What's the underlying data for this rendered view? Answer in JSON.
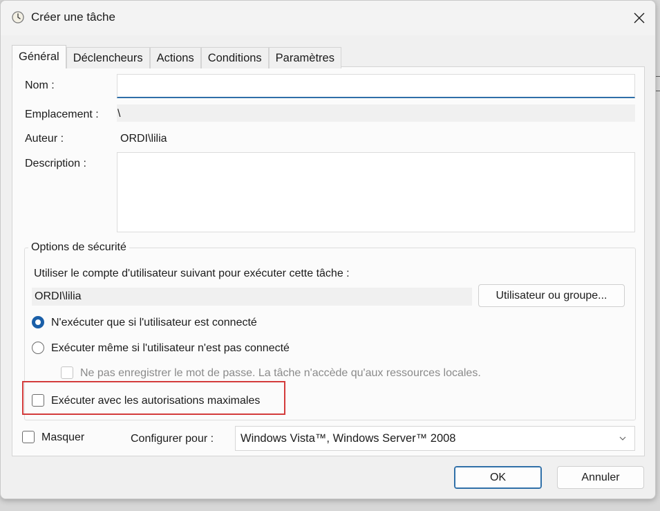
{
  "window": {
    "title": "Créer une tâche"
  },
  "tabs": [
    "Général",
    "Déclencheurs",
    "Actions",
    "Conditions",
    "Paramètres"
  ],
  "general": {
    "name_label": "Nom :",
    "name_value": "",
    "location_label": "Emplacement :",
    "location_value": "\\",
    "author_label": "Auteur :",
    "author_value": "ORDI\\lilia",
    "description_label": "Description :",
    "description_value": ""
  },
  "security": {
    "group_title": "Options de sécurité",
    "account_prompt": "Utiliser le compte d'utilisateur suivant pour exécuter cette tâche :",
    "account_value": "ORDI\\lilia",
    "user_group_button": "Utilisateur ou groupe...",
    "radio_logged_on": "N'exécuter que si l'utilisateur est connecté",
    "radio_logged_on_selected": true,
    "radio_any": "Exécuter même si l'utilisateur n'est pas connecté",
    "no_store_password": "Ne pas enregistrer le mot de passe. La tâche n'accède qu'aux ressources locales.",
    "highest_privileges": "Exécuter avec les autorisations maximales"
  },
  "bottom": {
    "hidden_label": "Masquer",
    "configure_label": "Configurer pour :",
    "configure_value": "Windows Vista™, Windows Server™ 2008"
  },
  "buttons": {
    "ok": "OK",
    "cancel": "Annuler"
  },
  "colors": {
    "accent": "#1a5fa8",
    "highlight": "#d33a3a"
  }
}
